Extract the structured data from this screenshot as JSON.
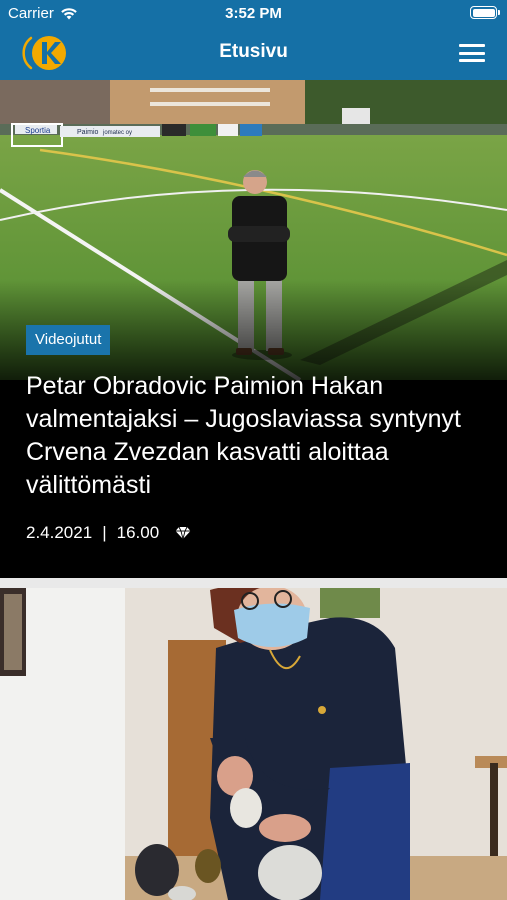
{
  "status_bar": {
    "carrier": "Carrier",
    "time": "3:52 PM"
  },
  "nav": {
    "title": "Etusivu",
    "logo_letter": "K"
  },
  "articles": [
    {
      "category": "Videojutut",
      "headline": "Petar Obradovic Paimion Hakan valmentajaksi – Jugoslaviassa syntynyt Crvena Zvezdan kasvatti aloittaa välittömästi",
      "date": "2.4.2021",
      "separator": "|",
      "time": "16.00",
      "premium_icon": "diamond-icon"
    },
    {
      "image": "woman-with-face-mask-photo"
    }
  ],
  "colors": {
    "brand_blue": "#1570a6",
    "logo_orange": "#f2a900",
    "category_badge": "#1a74ab"
  },
  "ad_banner_texts": [
    "Sportia",
    "Paimio",
    "jomatec oy"
  ]
}
